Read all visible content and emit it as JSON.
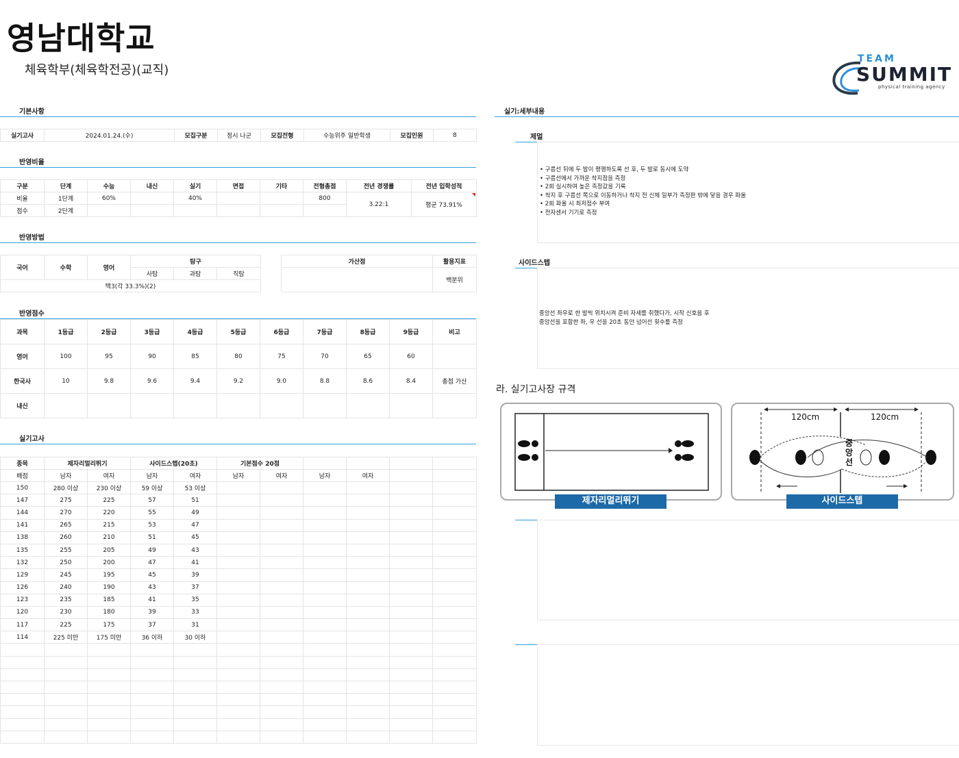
{
  "header": {
    "university": "영남대학교",
    "department": "체육학부(체육학전공)(교직)",
    "logo": {
      "team": "TEAM",
      "summit": "SUMMIT",
      "tagline": "physical training agency"
    }
  },
  "sections": {
    "basic": "기본사항",
    "ratio": "반영비율",
    "method": "반영방법",
    "score": "반영점수",
    "practical": "실기고사",
    "detail": "실기:세부내용"
  },
  "basic": {
    "exam_label": "실기고사",
    "exam_date": "2024.01.24.(수)",
    "type_label": "모집구분",
    "type_value": "정시 나군",
    "track_label": "모집전형",
    "track_value": "수능위주 일반학생",
    "quota_label": "모집인원",
    "quota_value": "8"
  },
  "ratio": {
    "headers": [
      "구분",
      "단계",
      "수능",
      "내신",
      "실기",
      "면접",
      "기타",
      "전형총점",
      "전년 경쟁률",
      "전년 입학성적"
    ],
    "row1": {
      "label": "비율",
      "stage": "1단계",
      "suneung": "60%",
      "naesin": "",
      "silgi": "40%",
      "interview": "",
      "etc": "",
      "total": "800"
    },
    "row2": {
      "label": "점수",
      "stage": "2단계"
    },
    "competition": "3.22:1",
    "prev_score": "평균 73.91%"
  },
  "method": {
    "korean": "국어",
    "math": "수학",
    "english": "영어",
    "inquiry": "탐구",
    "social": "사탐",
    "science": "과탐",
    "vocational": "직탐",
    "selection": "택3(각 33.3%)(2)",
    "bonus": "가산점",
    "indicator": "활용지표",
    "indicator_value": "백분위"
  },
  "score": {
    "headers": [
      "과목",
      "1등급",
      "2등급",
      "3등급",
      "4등급",
      "5등급",
      "6등급",
      "7등급",
      "8등급",
      "9등급",
      "비고"
    ],
    "rows": [
      [
        "영어",
        "100",
        "95",
        "90",
        "85",
        "80",
        "75",
        "70",
        "65",
        "60",
        ""
      ],
      [
        "한국사",
        "10",
        "9.8",
        "9.6",
        "9.4",
        "9.2",
        "9.0",
        "8.8",
        "8.6",
        "8.4",
        "총점 가산"
      ],
      [
        "내신",
        "",
        "",
        "",
        "",
        "",
        "",
        "",
        "",
        "",
        ""
      ]
    ]
  },
  "practical": {
    "event_label": "종목",
    "score_label": "배점",
    "event1": "제자리멀리뛰기",
    "event2": "사이드스텝(20초)",
    "event3": "기본점수 20점",
    "male": "남자",
    "female": "여자",
    "rows": [
      [
        "150",
        "280 이상",
        "230 이상",
        "59 이상",
        "53 이상"
      ],
      [
        "147",
        "275",
        "225",
        "57",
        "51"
      ],
      [
        "144",
        "270",
        "220",
        "55",
        "49"
      ],
      [
        "141",
        "265",
        "215",
        "53",
        "47"
      ],
      [
        "138",
        "260",
        "210",
        "51",
        "45"
      ],
      [
        "135",
        "255",
        "205",
        "49",
        "43"
      ],
      [
        "132",
        "250",
        "200",
        "47",
        "41"
      ],
      [
        "129",
        "245",
        "195",
        "45",
        "39"
      ],
      [
        "126",
        "240",
        "190",
        "43",
        "37"
      ],
      [
        "123",
        "235",
        "185",
        "41",
        "35"
      ],
      [
        "120",
        "230",
        "180",
        "39",
        "33"
      ],
      [
        "117",
        "225",
        "175",
        "37",
        "31"
      ],
      [
        "114",
        "225 미만",
        "175 미만",
        "36 이하",
        "30 이하"
      ]
    ]
  },
  "detail": {
    "jump_title": "제멀",
    "jump_bullets": [
      "구름선 뒤에 두 발이 평행하도록 선 후, 두 발로 동시에 도약",
      "구름선에서 가까운 착지점을 측정",
      "2회 실시하여 높은 측정값을 기록",
      "착지 후 구름선 쪽으로 이동하거나 착지 전 신체 일부가 측정판 밖에 닿을 경우 파울",
      "2회 파울 시 최저점수 부여",
      "전자센서 기기로 측정"
    ],
    "side_title": "사이드스텝",
    "side_text": [
      "중앙선 좌우로 한 발씩 위치시켜 준비 자세를 취했다가, 시작 신호음 후",
      "중앙선을 포함한 좌, 우 선을 20초 동안 넘어선 횟수를 측정"
    ],
    "spec_title": "라. 실기고사장 규격",
    "diagram1_label": "제자리멀리뛰기",
    "diagram2_label": "사이드스텝",
    "dist_left": "120cm",
    "dist_right": "120cm",
    "center_line": "중앙선"
  },
  "colors": {
    "accent_line": "#2e9fd8",
    "label_blue": "#1d6aa8"
  }
}
